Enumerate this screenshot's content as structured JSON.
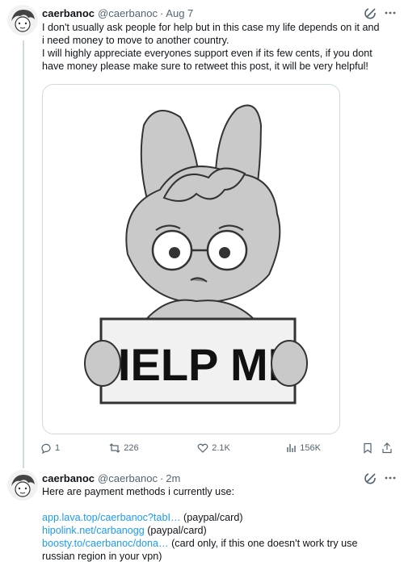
{
  "tweet1": {
    "name": "caerbanoc",
    "handle": "@caerbanoc",
    "separator": "·",
    "time": "Aug 7",
    "lines": [
      "I don't usually ask people for help but in this case my life depends on it and",
      "i need money to move to another country.",
      "I will highly appreciate everyones support even if its few cents, if you dont",
      "have money please make sure to retweet this post, it will be very helpful!"
    ],
    "image_sign_text": "HELP ME",
    "stats": {
      "replies": "1",
      "retweets": "226",
      "likes": "2.1K",
      "views": "156K"
    }
  },
  "tweet2": {
    "name": "caerbanoc",
    "handle": "@caerbanoc",
    "separator": "·",
    "time": "2m",
    "intro": "Here are payment methods i currently use:",
    "links": [
      {
        "url": "app.lava.top/caerbanoc?tabI…",
        "note": " (paypal/card)"
      },
      {
        "url": "hipolink.net/carbanogg",
        "note": " (paypal/card)"
      },
      {
        "url": "boosty.to/caerbanoc/dona…",
        "note": " (card only, if this one doesn't work try use"
      }
    ],
    "continuation": "russian region in your vpn)"
  },
  "icons": {
    "more": "more-icon",
    "grok": "grok-icon",
    "reply": "reply-icon",
    "retweet": "retweet-icon",
    "like": "like-icon",
    "views": "views-icon",
    "bookmark": "bookmark-icon",
    "share": "share-icon"
  },
  "colors": {
    "link": "#1d9bf0",
    "muted": "#536471",
    "border": "#cfd9de"
  }
}
